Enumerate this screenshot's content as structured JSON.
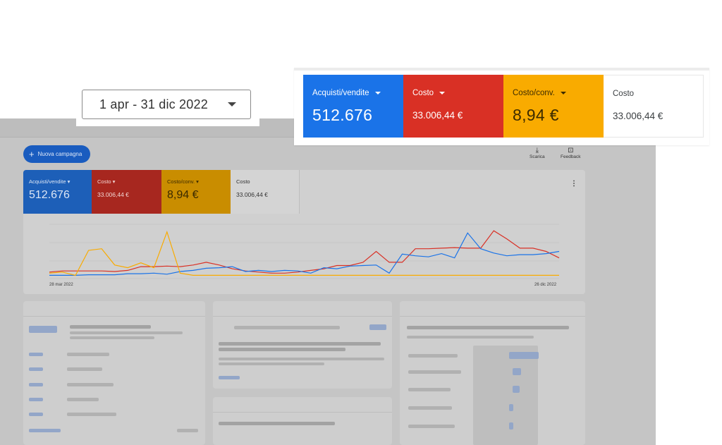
{
  "date_range": {
    "label": "1 apr - 31 dic 2022"
  },
  "metrics": [
    {
      "label": "Acquisti/vendite",
      "value": "512.676",
      "color": "#1a73e8",
      "dim_color": "#1d5fb8",
      "has_dropdown": true
    },
    {
      "label": "Costo",
      "value": "33.006,44 €",
      "color": "#d93025",
      "dim_color": "#a7271f",
      "has_dropdown": true
    },
    {
      "label": "Costo/conv.",
      "value": "8,94 €",
      "color": "#f9ab00",
      "dim_color": "#c98d00",
      "has_dropdown": true
    },
    {
      "label": "Costo",
      "value": "33.006,44 €",
      "color": "#ffffff",
      "dim_color": "#d4d4d4",
      "has_dropdown": false
    }
  ],
  "dashboard": {
    "new_campaign_label": "Nuova campagna",
    "download_label": "Scarica",
    "feedback_label": "Feedback",
    "chart": {
      "x_start": "28 mar 2022",
      "x_end": "26 dic 2022"
    }
  },
  "chart_data": {
    "type": "line",
    "x": [
      "28 mar 2022",
      "",
      "",
      "",
      "",
      "",
      "",
      "",
      "",
      "",
      "",
      "",
      "",
      "",
      "",
      "",
      "",
      "",
      "",
      "",
      "",
      "",
      "",
      "",
      "",
      "",
      "",
      "",
      "",
      "",
      "",
      "",
      "",
      "",
      "",
      "",
      "",
      "",
      "",
      "26 dic 2022"
    ],
    "series": [
      {
        "color": "#d93025",
        "values": [
          0.12,
          0.14,
          0.14,
          0.14,
          0.14,
          0.13,
          0.15,
          0.22,
          0.22,
          0.23,
          0.22,
          0.25,
          0.3,
          0.25,
          0.18,
          0.14,
          0.12,
          0.1,
          0.1,
          0.12,
          0.15,
          0.18,
          0.24,
          0.24,
          0.3,
          0.5,
          0.3,
          0.3,
          0.55,
          0.55,
          0.56,
          0.57,
          0.56,
          0.56,
          0.88,
          0.73,
          0.56,
          0.56,
          0.5,
          0.38
        ]
      },
      {
        "color": "#1a73e8",
        "values": [
          0.06,
          0.06,
          0.06,
          0.07,
          0.07,
          0.07,
          0.09,
          0.09,
          0.1,
          0.08,
          0.13,
          0.15,
          0.19,
          0.2,
          0.22,
          0.13,
          0.15,
          0.13,
          0.15,
          0.14,
          0.1,
          0.2,
          0.18,
          0.23,
          0.24,
          0.25,
          0.1,
          0.45,
          0.42,
          0.4,
          0.46,
          0.38,
          0.84,
          0.55,
          0.47,
          0.42,
          0.44,
          0.44,
          0.46,
          0.5
        ]
      },
      {
        "color": "#f9ab00",
        "values": [
          0.1,
          0.12,
          0.06,
          0.52,
          0.55,
          0.25,
          0.2,
          0.29,
          0.2,
          0.86,
          0.1,
          0.06,
          0.06,
          0.06,
          0.06,
          0.06,
          0.06,
          0.06,
          0.06,
          0.06,
          0.06,
          0.06,
          0.06,
          0.06,
          0.06,
          0.06,
          0.06,
          0.06,
          0.06,
          0.06,
          0.06,
          0.06,
          0.06,
          0.06,
          0.06,
          0.06,
          0.06,
          0.06,
          0.06,
          0.06
        ]
      }
    ]
  }
}
